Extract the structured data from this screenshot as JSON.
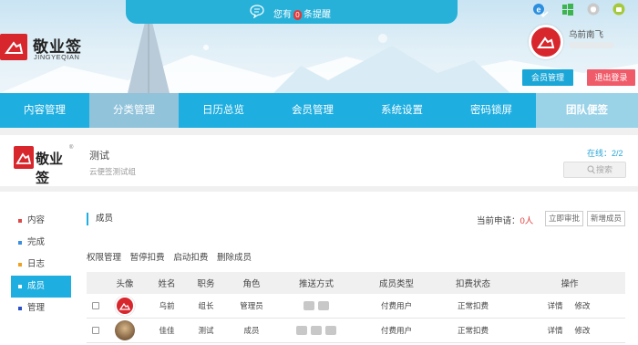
{
  "header": {
    "notice_prefix": "您有",
    "notice_count": "0",
    "notice_suffix": "条提醒",
    "logo_name": "敬业签",
    "logo_pinyin": "JINGYEQIAN",
    "user_name": "乌前南飞",
    "member_button": "会员管理",
    "logout_button": "退出登录",
    "os_icons": [
      "ie-icon",
      "windows-icon",
      "apple-icon",
      "android-icon"
    ]
  },
  "nav": {
    "tabs": [
      {
        "label": "内容管理"
      },
      {
        "label": "分类管理"
      },
      {
        "label": "日历总览"
      },
      {
        "label": "会员管理"
      },
      {
        "label": "系统设置"
      },
      {
        "label": "密码锁屏"
      },
      {
        "label": "团队便签"
      }
    ]
  },
  "group": {
    "logo_name": "敬业签",
    "logo_reg": "®",
    "name": "测试",
    "description": "云便签测试组",
    "online_label": "在线：",
    "online_value": "2/2",
    "search_placeholder": "搜索"
  },
  "sidebar": {
    "items": [
      {
        "label": "内容",
        "color": "#e04848"
      },
      {
        "label": "完成",
        "color": "#3a8fe0"
      },
      {
        "label": "日志",
        "color": "#f0a020"
      },
      {
        "label": "成员",
        "color": "#ffffff"
      },
      {
        "label": "管理",
        "color": "#2a4fc8"
      }
    ]
  },
  "members": {
    "title": "成员",
    "apply_label": "当前申请：",
    "apply_count": "0人",
    "approve_button": "立即审批",
    "add_button": "新增成员",
    "actions": [
      "权限管理",
      "暂停扣费",
      "启动扣费",
      "删除成员"
    ],
    "columns": [
      "头像",
      "姓名",
      "职务",
      "角色",
      "推送方式",
      "成员类型",
      "扣费状态",
      "操作"
    ],
    "rows": [
      {
        "name": "乌前",
        "position": "组长",
        "role": "管理员",
        "type": "付费用户",
        "status": "正常扣费",
        "detail": "详情",
        "edit": "修改"
      },
      {
        "name": "佳佳",
        "position": "测试",
        "role": "成员",
        "type": "付费用户",
        "status": "正常扣费",
        "detail": "详情",
        "edit": "修改"
      }
    ]
  }
}
